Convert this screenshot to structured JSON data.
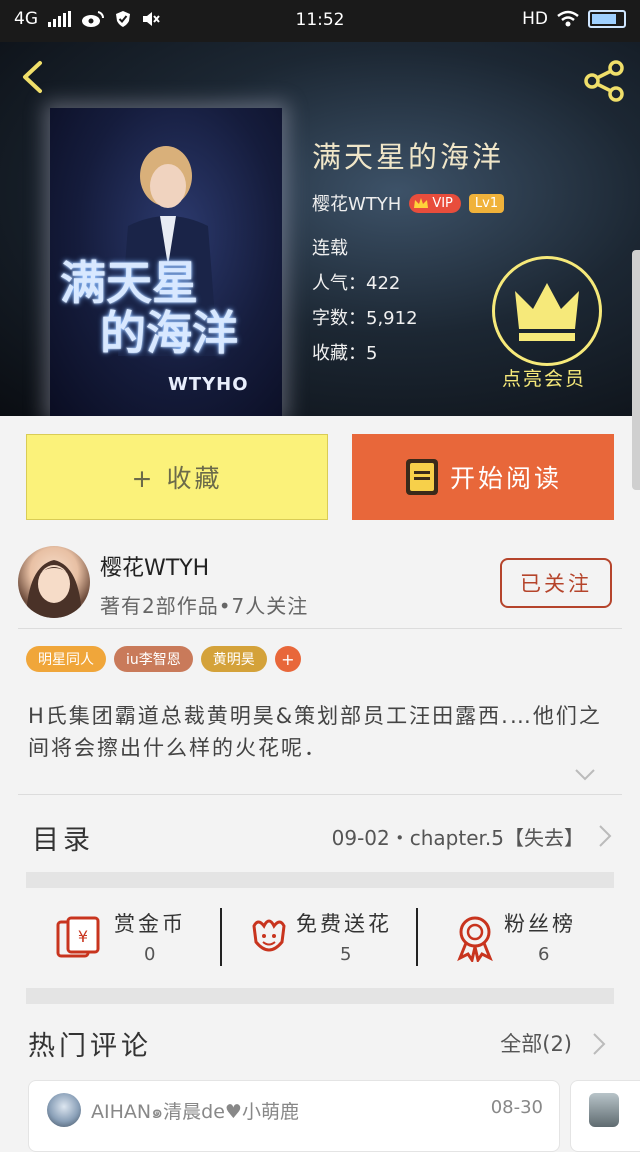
{
  "status_bar": {
    "network": "4G",
    "time": "11:52",
    "hd": "HD"
  },
  "book": {
    "title": "满天星的海洋",
    "author": "樱花WTYH",
    "vip_label": "VIP",
    "level": "Lv1",
    "status": "连载",
    "popularity": "人气：422",
    "word_count": "字数：5,912",
    "favorites": "收藏：5",
    "cover_title_line1": "满天星",
    "cover_title_line2": "的海洋",
    "cover_subtitle": "WTYHO",
    "vip_badge_label": "点亮会员"
  },
  "actions": {
    "favorite_label": "+ 收藏",
    "read_label": "开始阅读"
  },
  "author_card": {
    "name": "樱花WTYH",
    "info": "著有2部作品•7人关注",
    "follow_label": "已关注"
  },
  "tags": [
    {
      "label": "明星同人",
      "color": "#f0a63a"
    },
    {
      "label": "iu李智恩",
      "color": "#c97a5a"
    },
    {
      "label": "黄明昊",
      "color": "#d4a23a"
    }
  ],
  "tag_add": "+",
  "description": "H氏集团霸道总裁黄明昊&策划部员工汪田露西.…他们之间将会擦出什么样的火花呢．",
  "toc": {
    "label": "目录",
    "latest": "09-02・chapter.5【失去】"
  },
  "stats": [
    {
      "label": "赏金币",
      "value": "0",
      "icon": "red-envelope-icon"
    },
    {
      "label": "免费送花",
      "value": "5",
      "icon": "flower-icon"
    },
    {
      "label": "粉丝榜",
      "value": "6",
      "icon": "ribbon-medal-icon"
    }
  ],
  "comments": {
    "heading": "热门评论",
    "all_label": "全部(2)",
    "items": [
      {
        "user": "AIHAN๑清晨de♥小萌鹿",
        "date": "08-30"
      }
    ]
  },
  "colors": {
    "accent": "#e8673a",
    "favorite_bg": "#fbf27a",
    "follow": "#b5442b",
    "crown": "#f6e97a"
  }
}
